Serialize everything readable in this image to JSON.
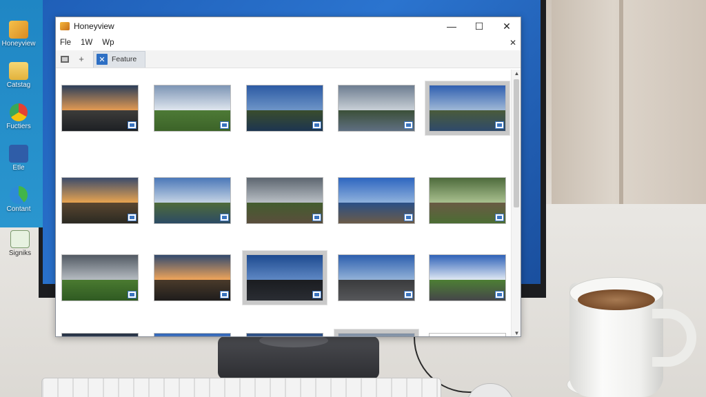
{
  "window": {
    "title": "Honeyview",
    "controls": {
      "minimize": "—",
      "maximize": "☐",
      "close": "✕"
    }
  },
  "menu": {
    "items": [
      "Fle",
      "1W",
      "Wp"
    ],
    "close_glyph": "✕"
  },
  "toolbar": {
    "add_glyph": "+",
    "tab_label": "Feature",
    "tab_close_glyph": "✕"
  },
  "desktop": {
    "icons": [
      {
        "label": "Honeyview",
        "icon": "honeyview-icon"
      },
      {
        "label": "Catstag",
        "icon": "folder-icon"
      },
      {
        "label": "Fuctiers",
        "icon": "chrome-icon"
      },
      {
        "label": "Etle",
        "icon": "facebook-icon"
      },
      {
        "label": "Contant",
        "icon": "edge-icon"
      },
      {
        "label": "Signiks",
        "icon": "play-icon"
      }
    ]
  },
  "gallery": {
    "thumbnails": [
      {
        "subject": "sunset-lake-figure",
        "selected": false
      },
      {
        "subject": "field-path-clouds",
        "selected": false
      },
      {
        "subject": "lake-reflection-blue",
        "selected": false
      },
      {
        "subject": "lake-clouds",
        "selected": false
      },
      {
        "subject": "mountain-lake",
        "selected": true
      },
      {
        "subject": "sunset-field",
        "selected": false
      },
      {
        "subject": "mountain-river",
        "selected": false
      },
      {
        "subject": "valley-path",
        "selected": false
      },
      {
        "subject": "pier-water",
        "selected": false
      },
      {
        "subject": "forest-path",
        "selected": false
      },
      {
        "subject": "green-hills",
        "selected": false
      },
      {
        "subject": "sunset-boardwalk-figure",
        "selected": false
      },
      {
        "subject": "tree-silhouettes",
        "selected": true
      },
      {
        "subject": "road-trees",
        "selected": false
      },
      {
        "subject": "open-road",
        "selected": false
      },
      {
        "subject": "city-building",
        "selected": false
      },
      {
        "subject": "cloud-sky",
        "selected": false
      },
      {
        "subject": "modern-house",
        "selected": false
      },
      {
        "subject": "clouds-horizon",
        "selected": true
      },
      {
        "subject": "orange-object",
        "selected": false
      }
    ]
  }
}
